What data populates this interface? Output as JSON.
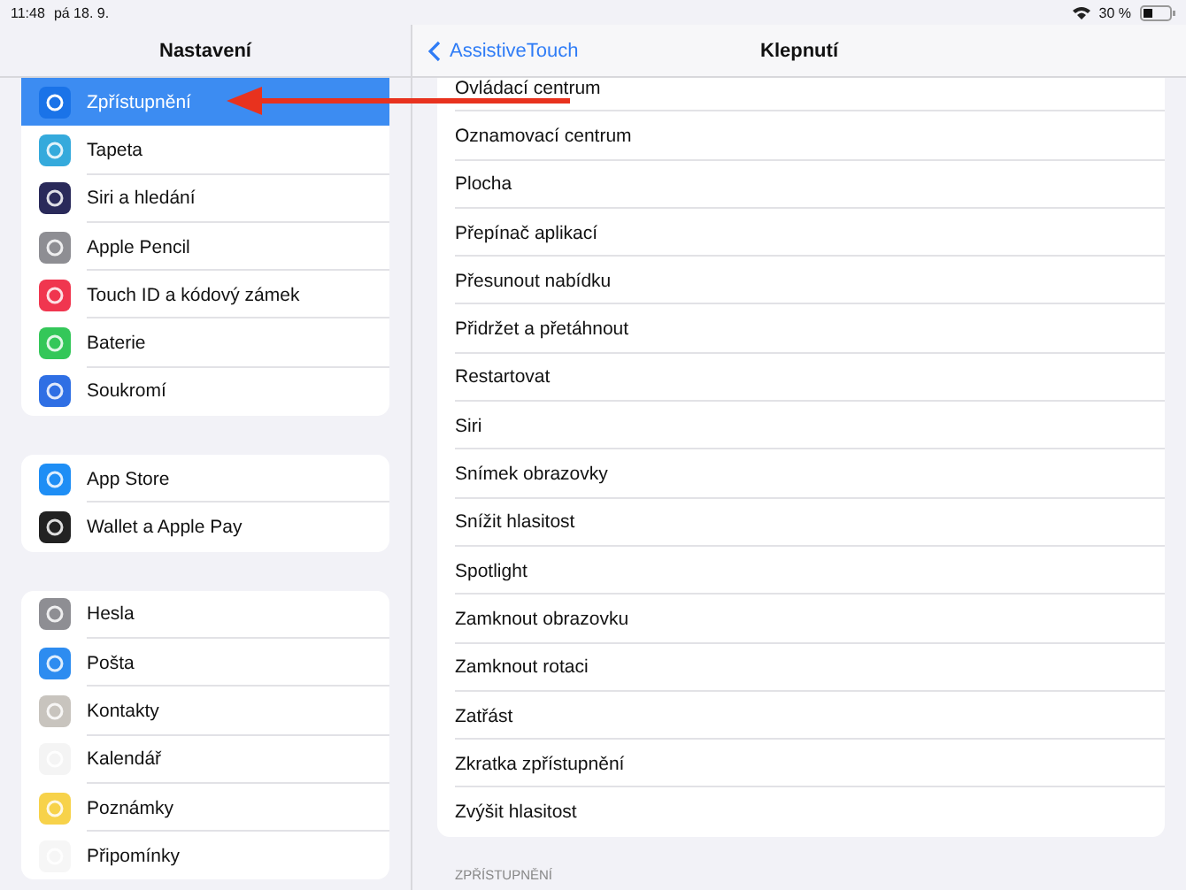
{
  "status_bar": {
    "time": "11:48",
    "date": "pá 18. 9.",
    "battery": "30 %"
  },
  "sidebar": {
    "title": "Nastavení",
    "groups": [
      [
        {
          "label": "Zpřístupnění",
          "selected": true,
          "color": "#1a73e8"
        },
        {
          "label": "Tapeta",
          "selected": false,
          "color": "#35aadc"
        },
        {
          "label": "Siri a hledání",
          "selected": false,
          "color": "#2a2a5a"
        },
        {
          "label": "Apple Pencil",
          "selected": false,
          "color": "#8e8e93"
        },
        {
          "label": "Touch ID a kódový zámek",
          "selected": false,
          "color": "#f0364f"
        },
        {
          "label": "Baterie",
          "selected": false,
          "color": "#34c759"
        },
        {
          "label": "Soukromí",
          "selected": false,
          "color": "#2f6fe4"
        }
      ],
      [
        {
          "label": "App Store",
          "selected": false,
          "color": "#1e8ef5"
        },
        {
          "label": "Wallet a Apple Pay",
          "selected": false,
          "color": "#222222"
        }
      ],
      [
        {
          "label": "Hesla",
          "selected": false,
          "color": "#8e8e93"
        },
        {
          "label": "Pošta",
          "selected": false,
          "color": "#2d8cf0"
        },
        {
          "label": "Kontakty",
          "selected": false,
          "color": "#c8c4be"
        },
        {
          "label": "Kalendář",
          "selected": false,
          "color": "#f4f4f4"
        },
        {
          "label": "Poznámky",
          "selected": false,
          "color": "#f7d24a"
        },
        {
          "label": "Připomínky",
          "selected": false,
          "color": "#f6f6f6"
        }
      ]
    ]
  },
  "detail": {
    "back": "AssistiveTouch",
    "title": "Klepnutí",
    "items": [
      "Ovládací centrum",
      "Oznamovací centrum",
      "Plocha",
      "Přepínač aplikací",
      "Přesunout nabídku",
      "Přidržet a přetáhnout",
      "Restartovat",
      "Siri",
      "Snímek obrazovky",
      "Snížit hlasitost",
      "Spotlight",
      "Zamknout obrazovku",
      "Zamknout rotaci",
      "Zatřást",
      "Zkratka zpřístupnění",
      "Zvýšit hlasitost"
    ],
    "section": "ZPŘÍSTUPNĚNÍ"
  }
}
